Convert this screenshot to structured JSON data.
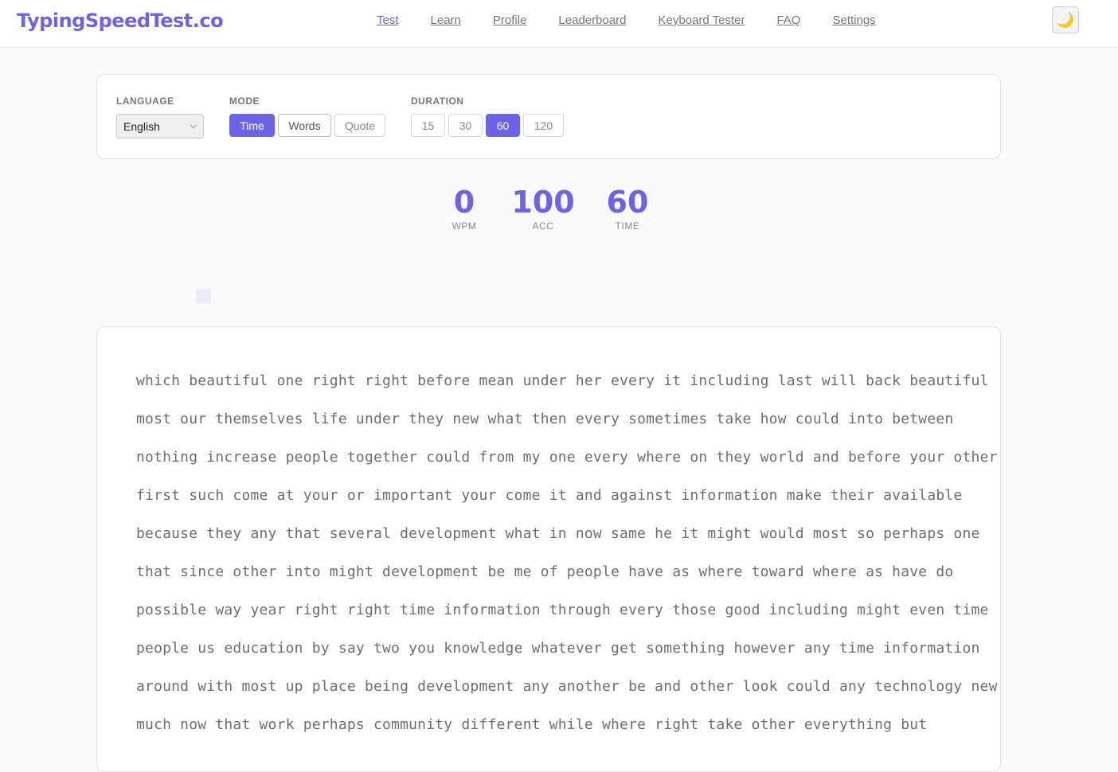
{
  "header": {
    "logo": "TypingSpeedTest.co",
    "nav": [
      "Test",
      "Learn",
      "Profile",
      "Leaderboard",
      "Keyboard Tester",
      "FAQ",
      "Settings"
    ],
    "active_nav": "Test",
    "theme_icon": "moon-icon",
    "theme_glyph": "🌙"
  },
  "settings": {
    "language": {
      "label": "LANGUAGE",
      "value": "English"
    },
    "mode": {
      "label": "MODE",
      "options": [
        "Time",
        "Words",
        "Quote"
      ],
      "selected": "Time"
    },
    "duration": {
      "label": "DURATION",
      "options": [
        "15",
        "30",
        "60",
        "120"
      ],
      "selected": "60"
    }
  },
  "stats": [
    {
      "value": "0",
      "label": "WPM"
    },
    {
      "value": "100",
      "label": "ACC"
    },
    {
      "value": "60",
      "label": "TIME"
    }
  ],
  "text_lines": [
    "which beautiful one right right before mean under her every it including last will back beautiful",
    "most our themselves life under they new what then every sometimes take how could into between",
    "nothing increase people together could from my one every where on they world and before your other",
    "first such come at your or important your come it and against information make their available",
    "because they any that several development what in now same he it might would most so perhaps one",
    "that since other into might development be me of people have as where toward where as have do",
    "possible way year right right time information through every those good including might even time",
    "people us education by say two you knowledge whatever get something however any time information",
    "around with most up place being development any another be and other look could any technology new",
    "much now that work perhaps community different while where right take other everything but"
  ],
  "colors": {
    "accent": "#6c63e6",
    "text": "#6e6e6e"
  }
}
